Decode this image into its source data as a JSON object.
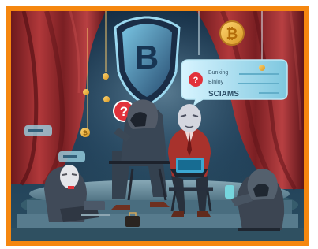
{
  "image": {
    "frame_color": "#f5870f",
    "scene": {
      "shield_letter": "B",
      "coin_symbol": "₿",
      "question_mark": "?",
      "speech_bubble": {
        "line1": "Bunking",
        "line2": "Binioy",
        "line3": "SCIAMS"
      },
      "palette": {
        "curtain": "#9e2a2a",
        "curtain_shadow": "#6d1a1d",
        "backdrop": "#1d3a53",
        "stage": "#4f7487",
        "suit_dark": "#2f3440",
        "suit_red": "#a8322c",
        "laptop_blue": "#3ca7d1",
        "coin_gold": "#e8b33a",
        "question_red": "#e2313a"
      }
    }
  }
}
